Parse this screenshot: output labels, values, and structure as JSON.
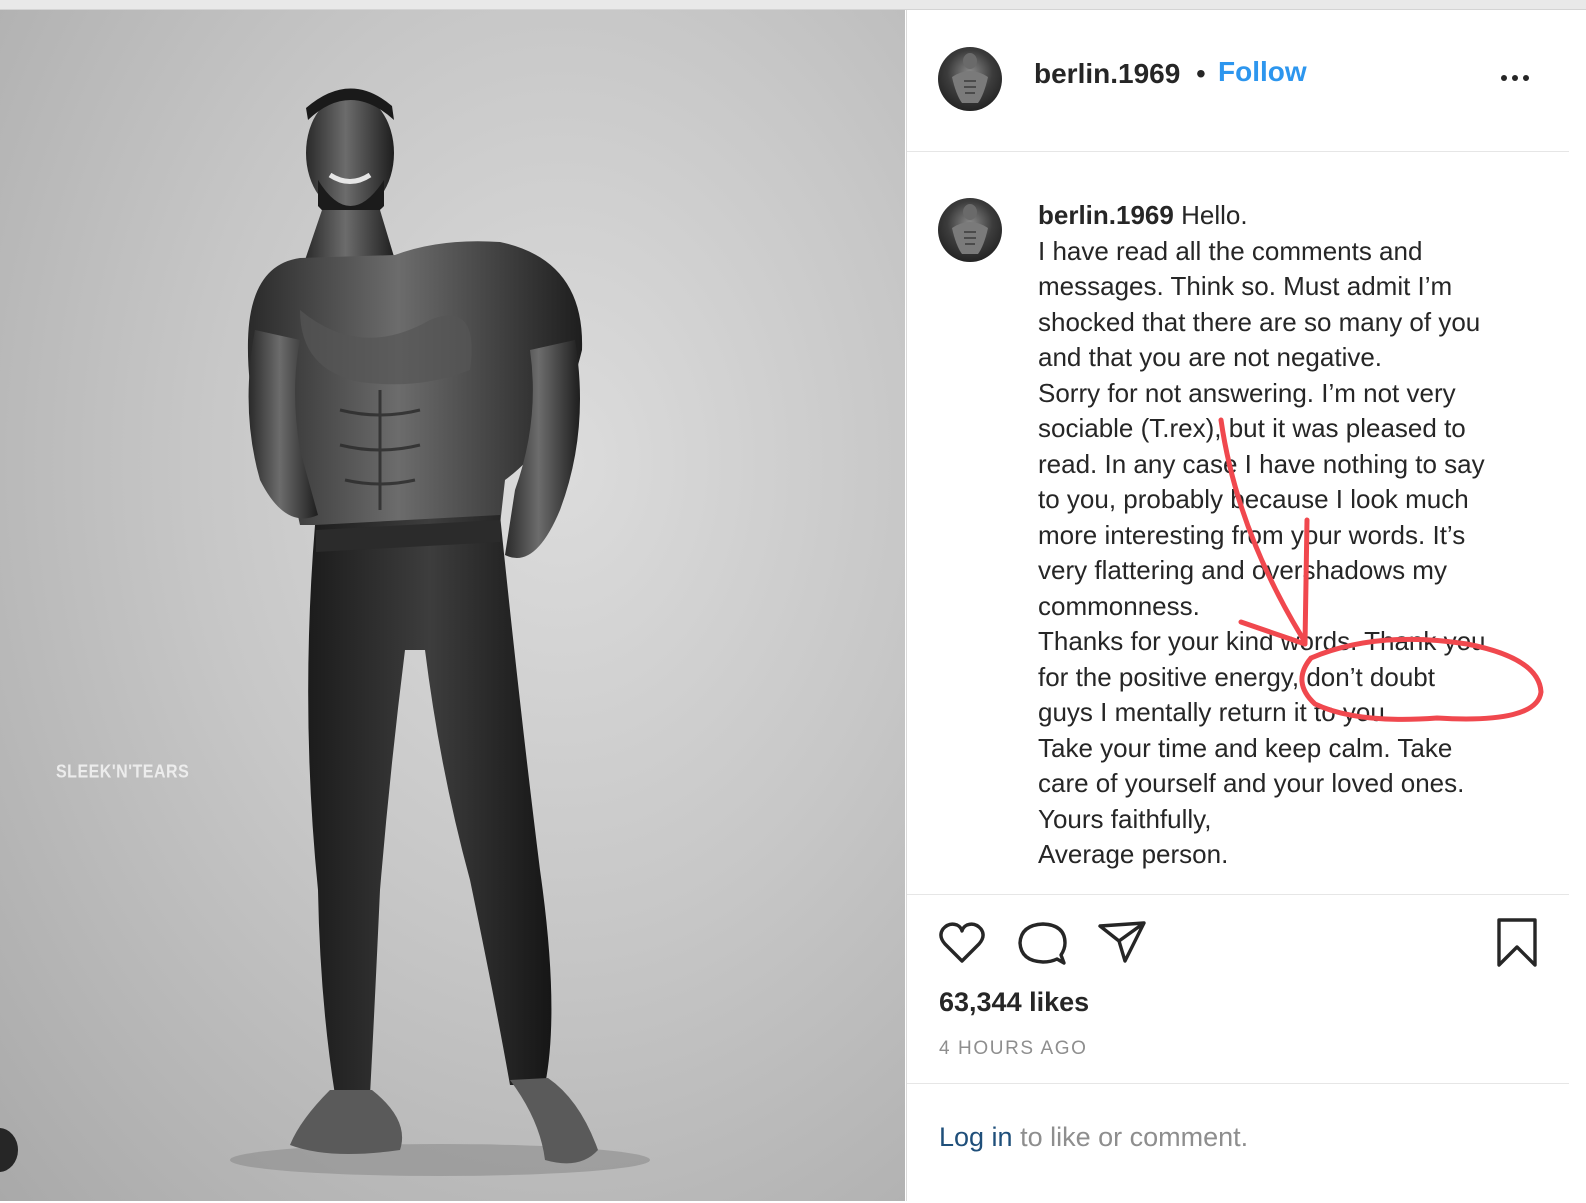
{
  "photo": {
    "watermark": "SLEEK'N'TEARS"
  },
  "header": {
    "username": "berlin.1969",
    "separator": "•",
    "follow_label": "Follow",
    "more_icon": "more-horizontal-icon"
  },
  "caption": {
    "username": "berlin.1969",
    "lines": [
      "Hello.",
      "I have read all the comments and",
      "messages. Think so. Must admit I’m",
      "shocked that there are so many of you",
      "and that you are not negative.",
      "Sorry for not answering. I’m not very",
      "sociable (T.rex), but it was pleased to",
      "read. In any case I have nothing to say",
      "to you, probably because I look much",
      "more interesting from your words. It’s",
      "very flattering and overshadows my",
      "commonness.",
      "Thanks for your kind words. Thank you",
      "for the positive energy, don’t doubt",
      "guys I mentally return it to you.",
      "Take your time and keep calm. Take",
      "care of yourself and your loved ones.",
      "Yours faithfully,",
      "Average person."
    ],
    "annotation_color": "#f0484e"
  },
  "actions": {
    "icons": [
      "heart-icon",
      "comment-icon",
      "send-icon",
      "bookmark-icon"
    ],
    "likes": "63,344 likes",
    "timestamp": "4 HOURS AGO"
  },
  "login": {
    "link": "Log in",
    "rest": " to like or comment."
  },
  "colors": {
    "accent": "#2d96ee",
    "text": "#262626",
    "muted": "#8e8e8e",
    "link": "#1f4f7a"
  }
}
